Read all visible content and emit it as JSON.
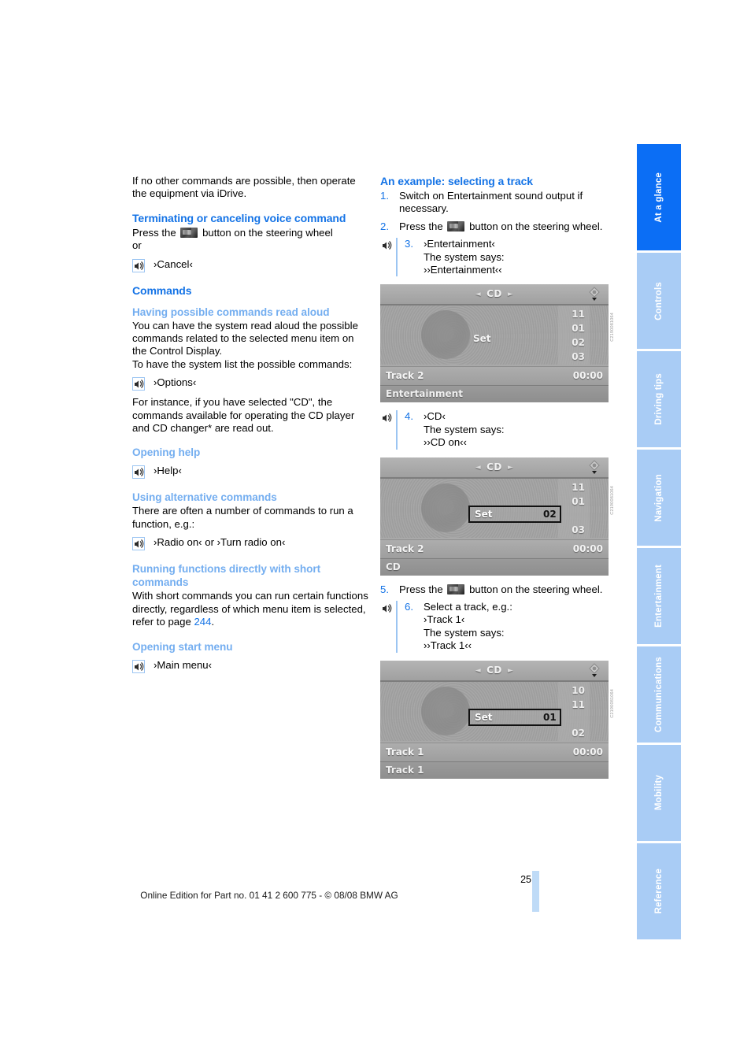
{
  "page": {
    "number": "25",
    "footer": "Online Edition for Part no. 01 41 2 600 775 - © 08/08 BMW AG"
  },
  "left_column": {
    "intro": "If no other commands are possible, then operate the equipment via iDrive.",
    "heading_terminating": "Terminating or canceling voice command",
    "press_button_pre": "Press the",
    "press_button_post": "button on the steering wheel",
    "or": "or",
    "cmd_cancel": "›Cancel‹",
    "heading_commands": "Commands",
    "subheading_read_aloud": "Having possible commands read aloud",
    "read_aloud_p1": "You can have the system read aloud the possible commands related to the selected menu item on the Control Display.",
    "read_aloud_p2": "To have the system list the possible commands:",
    "cmd_options": "›Options‹",
    "read_aloud_p3": "For instance, if you have selected \"CD\", the commands available for operating the CD player and CD changer* are read out.",
    "subheading_help": "Opening help",
    "cmd_help": "›Help‹",
    "subheading_alternative": "Using alternative commands",
    "alternative_p1": "There are often a number of commands to run a function, e.g.:",
    "cmd_radio": "›Radio on‹  or ›Turn radio on‹",
    "subheading_short": "Running functions directly with short commands",
    "short_p1_a": "With short commands you can run certain functions directly, regardless of which menu item is selected, refer to page ",
    "short_p1_page": "244",
    "short_p1_b": ".",
    "subheading_start_menu": "Opening start menu",
    "cmd_main_menu": "›Main menu‹"
  },
  "right_column": {
    "heading_example": "An example: selecting a track",
    "steps": [
      {
        "num": "1.",
        "text": "Switch on Entertainment sound output if necessary."
      },
      {
        "num": "2.",
        "text_pre": "Press the",
        "text_post": "button on the steering wheel."
      }
    ],
    "step3": {
      "num": "3.",
      "command": "›Entertainment‹",
      "says_label": "The system says:",
      "says": "››Entertainment‹‹"
    },
    "step4": {
      "num": "4.",
      "command": "›CD‹",
      "says_label": "The system says:",
      "says": "››CD on‹‹"
    },
    "step5": {
      "num": "5.",
      "text_pre": "Press the",
      "text_post": "button on the steering wheel."
    },
    "step6": {
      "num": "6.",
      "lead": "Select a track, e.g.:",
      "command": "›Track 1‹",
      "says_label": "The system says:",
      "says": "››Track 1‹‹"
    }
  },
  "figures": [
    {
      "header_title": "CD",
      "arrow_left": "◄",
      "arrow_right": "►",
      "set_label": "Set",
      "numbers": [
        "11",
        "01",
        "02",
        "03"
      ],
      "selected_index": null,
      "track_name": "Track 2",
      "track_time": "00:00",
      "footer_text": "Entertainment",
      "code": "C2190081064"
    },
    {
      "header_title": "CD",
      "arrow_left": "◄",
      "arrow_right": "►",
      "set_label": "Set",
      "numbers": [
        "11",
        "01",
        "02",
        "03"
      ],
      "selected_index": 2,
      "selected_value": "02",
      "track_name": "Track 2",
      "track_time": "00:00",
      "footer_text": "CD",
      "code": "C2190081064"
    },
    {
      "header_title": "CD",
      "arrow_left": "◄",
      "arrow_right": "►",
      "set_label": "Set",
      "numbers": [
        "10",
        "11",
        "01",
        "02"
      ],
      "selected_index": 2,
      "selected_value": "01",
      "track_name": "Track 1",
      "track_time": "00:00",
      "footer_text": "Track 1",
      "code": "C2190081064"
    }
  ],
  "tabs": [
    {
      "label": "At a glance",
      "active": true
    },
    {
      "label": "Controls",
      "active": false
    },
    {
      "label": "Driving tips",
      "active": false
    },
    {
      "label": "Navigation",
      "active": false
    },
    {
      "label": "Entertainment",
      "active": false
    },
    {
      "label": "Communications",
      "active": false
    },
    {
      "label": "Mobility",
      "active": false
    },
    {
      "label": "Reference",
      "active": false
    }
  ],
  "colors": {
    "heading_blue": "#1473e6",
    "subheading_blue": "#74aef0",
    "tab_active": "#0b6ef5",
    "tab_inactive": "#a9ccf5",
    "rule_blue": "#9cc5f2"
  }
}
